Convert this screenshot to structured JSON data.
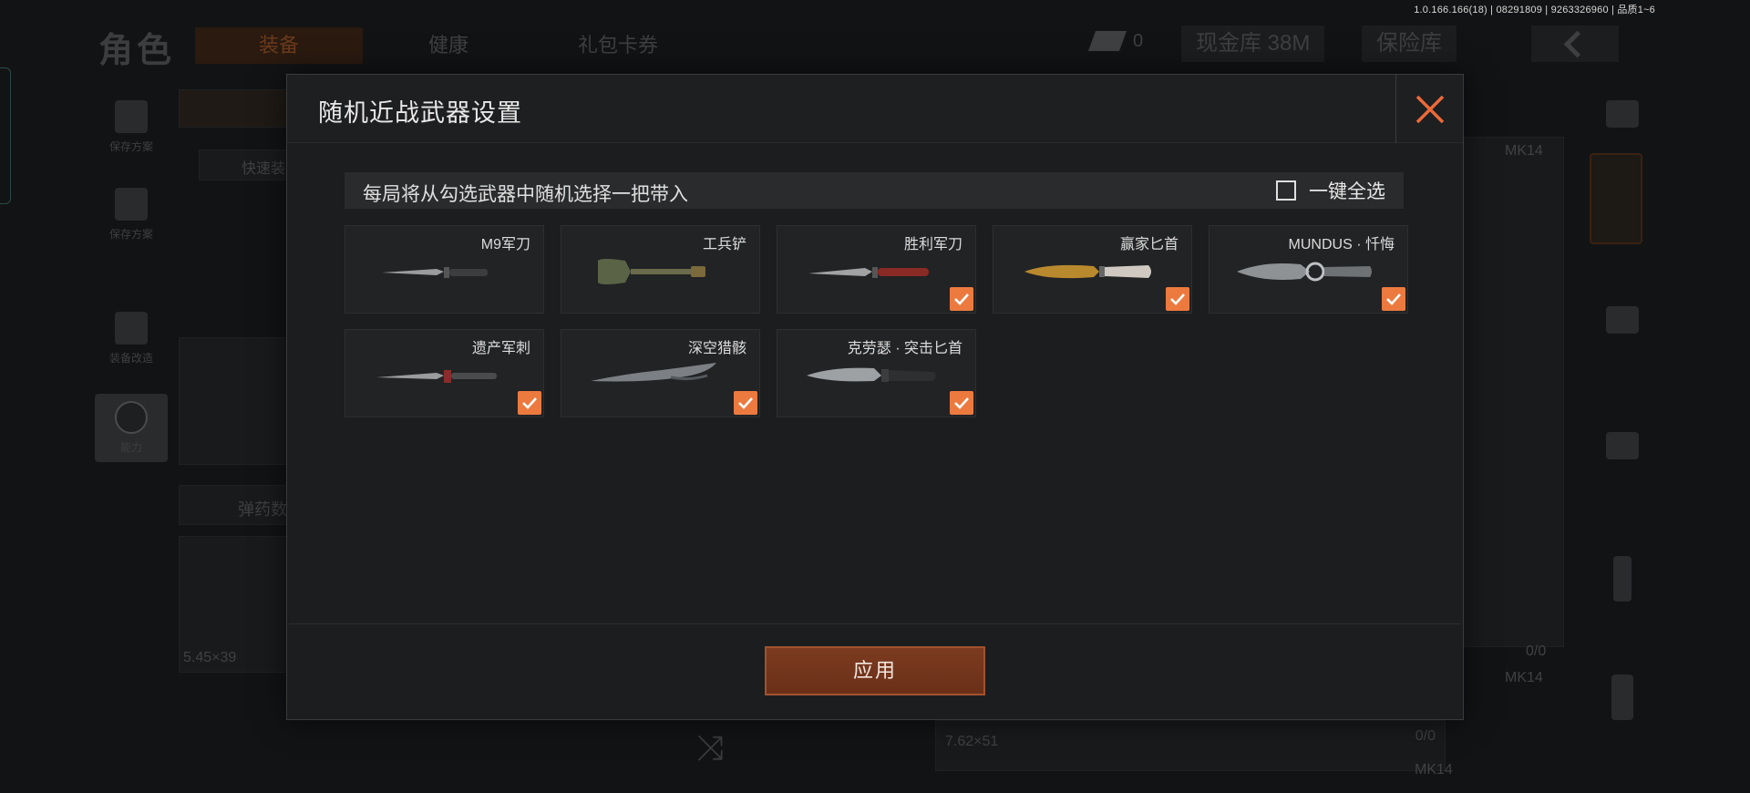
{
  "version_text": "1.0.166.166(18) | 08291809 | 9263326960 | 品质1~6",
  "background": {
    "page_title": "角色",
    "tabs": [
      {
        "label": "装备"
      },
      {
        "label": "健康"
      },
      {
        "label": "礼包卡券"
      }
    ],
    "currency_count": "0",
    "cash_storage": "现金库 38M",
    "safe_box": "保险库",
    "side_items": [
      {
        "label": "保存方案"
      },
      {
        "label": "保存方案"
      },
      {
        "label": "装备改造"
      },
      {
        "label": "能力"
      }
    ],
    "quick_equip": "快速装",
    "ammo_label": "弹药数",
    "ammo_caliber_left": "5.45×39",
    "ammo_caliber_mid": "7.62×51",
    "right_labels": [
      "MK14",
      "MK14",
      "MK14"
    ],
    "right_counts": [
      "0/0",
      "0/0"
    ]
  },
  "modal": {
    "title": "随机近战武器设置",
    "hint": "每局将从勾选武器中随机选择一把带入",
    "select_all_label": "一键全选",
    "select_all_checked": false,
    "apply_label": "应用",
    "weapons": [
      {
        "name": "M9军刀",
        "checked": false,
        "icon": "bayonet-icon",
        "blade_color": "#9a9c9e"
      },
      {
        "name": "工兵铲",
        "checked": false,
        "icon": "shovel-icon",
        "blade_color": "#5b6347"
      },
      {
        "name": "胜利军刀",
        "checked": true,
        "icon": "knife-icon",
        "blade_color": "#8a2a25"
      },
      {
        "name": "赢家匕首",
        "checked": true,
        "icon": "dagger-icon",
        "blade_color": "#b9892d"
      },
      {
        "name": "MUNDUS · 忏悔",
        "checked": true,
        "icon": "ornate-blade-icon",
        "blade_color": "#8f9295"
      },
      {
        "name": "遗产军刺",
        "checked": true,
        "icon": "bayonet-icon",
        "blade_color": "#8b2b2b"
      },
      {
        "name": "深空猎骸",
        "checked": true,
        "icon": "curved-blade-icon",
        "blade_color": "#7c8084"
      },
      {
        "name": "克劳瑟 · 突击匕首",
        "checked": true,
        "icon": "combat-knife-icon",
        "blade_color": "#9ea1a4"
      }
    ],
    "accent_color": "#ec7a3f"
  }
}
